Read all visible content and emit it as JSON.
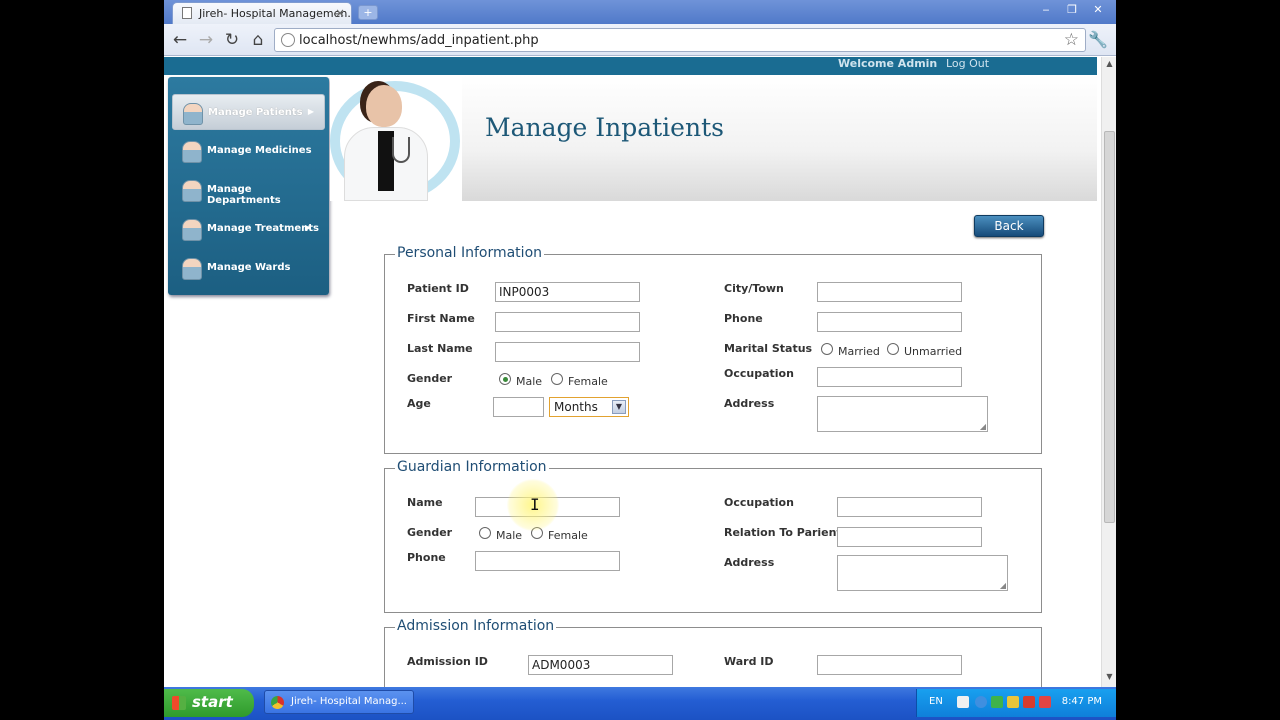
{
  "browser": {
    "tab_title": "Jireh- Hospital Managemen…",
    "tab_close": "×",
    "new_tab": "+",
    "url": "localhost/newhms/add_inpatient.php",
    "window_buttons": [
      "‒",
      "❐",
      "✕"
    ],
    "nav": {
      "back": "←",
      "forward": "→",
      "reload": "↻",
      "home": "⌂"
    },
    "star": "☆",
    "wrench": "🔧"
  },
  "header": {
    "welcome": "Welcome Admin",
    "logout": "Log Out",
    "title": "Manage Inpatients"
  },
  "sidebar": {
    "items": [
      {
        "label": "Manage Patients",
        "has_submenu": true,
        "active": true
      },
      {
        "label": "Manage Medicines",
        "has_submenu": false
      },
      {
        "label": "Manage Departments",
        "has_submenu": false
      },
      {
        "label": "Manage Treatments",
        "has_submenu": true
      },
      {
        "label": "Manage Wards",
        "has_submenu": false
      }
    ]
  },
  "back_label": "Back",
  "personal": {
    "legend": "Personal Information",
    "patient_id_label": "Patient ID",
    "patient_id_value": "INP0003",
    "first_name_label": "First Name",
    "last_name_label": "Last Name",
    "gender_label": "Gender",
    "male": "Male",
    "female": "Female",
    "age_label": "Age",
    "age_unit": "Months",
    "city_label": "City/Town",
    "phone_label": "Phone",
    "marital_label": "Marital Status",
    "married": "Married",
    "unmarried": "Unmarried",
    "occupation_label": "Occupation",
    "address_label": "Address"
  },
  "guardian": {
    "legend": "Guardian Information",
    "name_label": "Name",
    "gender_label": "Gender",
    "male": "Male",
    "female": "Female",
    "phone_label": "Phone",
    "occupation_label": "Occupation",
    "relation_label": "Relation To Parient",
    "address_label": "Address"
  },
  "admission": {
    "legend": "Admission Information",
    "admission_id_label": "Admission ID",
    "admission_id_value": "ADM0003",
    "ward_id_label": "Ward ID"
  },
  "taskbar": {
    "start": "start",
    "task": "Jireh- Hospital Manag...",
    "lang": "EN",
    "clock": "8:47 PM"
  },
  "colors": {
    "accent": "#1a6c92",
    "legend": "#1f4d74",
    "title": "#1d5877"
  }
}
